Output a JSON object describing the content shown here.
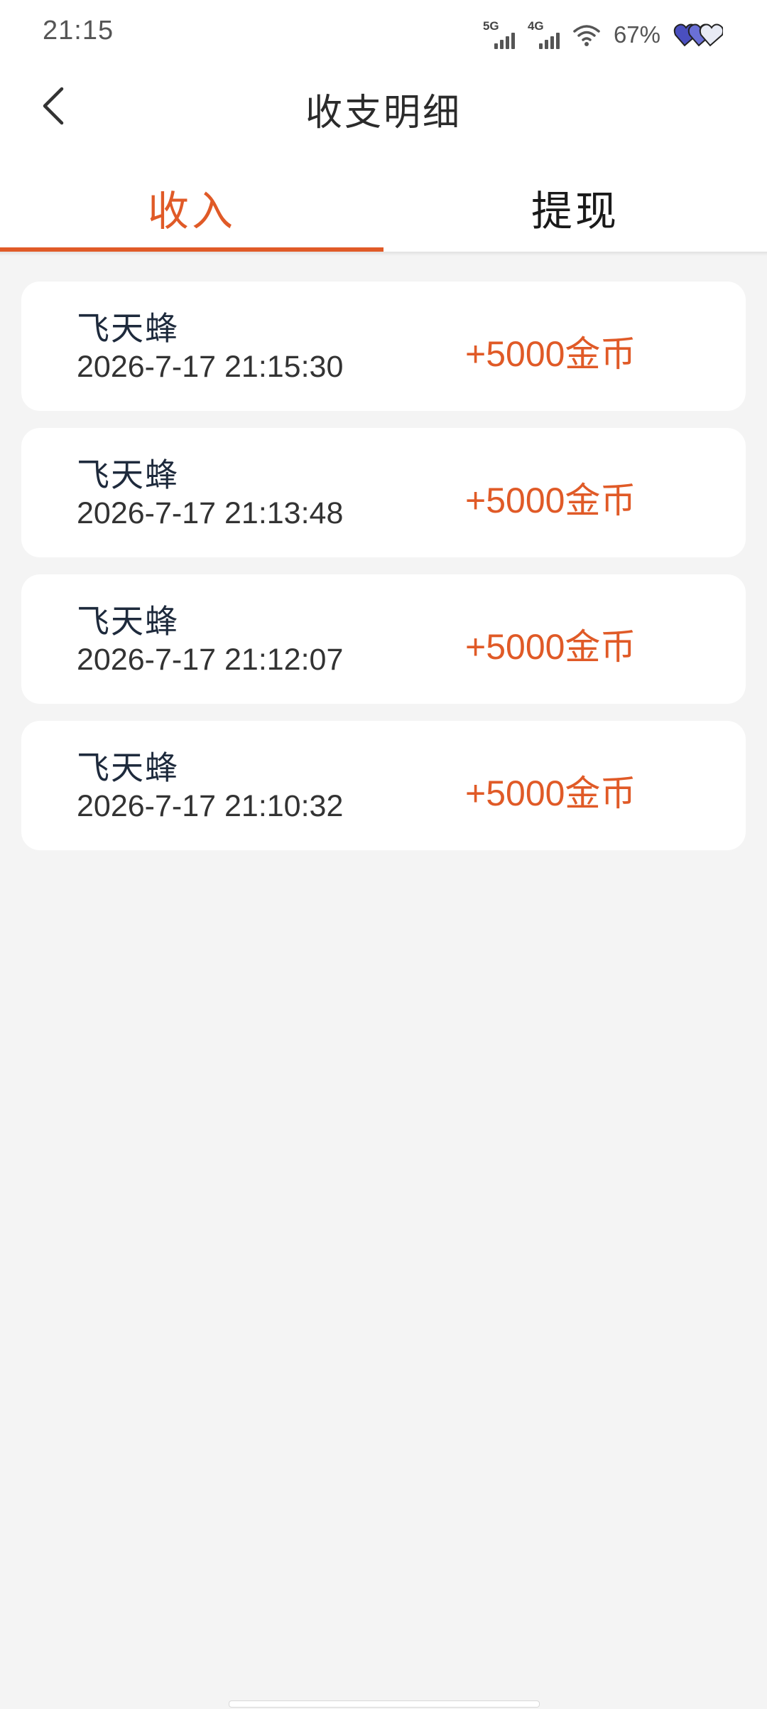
{
  "status_bar": {
    "time": "21:15",
    "network1": "5G",
    "network2": "4G",
    "battery": "67%"
  },
  "header": {
    "title": "收支明细",
    "back_icon": "chevron-left-icon"
  },
  "tabs": [
    {
      "label": "收入",
      "active": true
    },
    {
      "label": "提现",
      "active": false
    }
  ],
  "records": [
    {
      "name": "飞天蜂",
      "time": "2026-7-17 21:15:30",
      "amount": "+5000金币"
    },
    {
      "name": "飞天蜂",
      "time": "2026-7-17 21:13:48",
      "amount": "+5000金币"
    },
    {
      "name": "飞天蜂",
      "time": "2026-7-17 21:12:07",
      "amount": "+5000金币"
    },
    {
      "name": "飞天蜂",
      "time": "2026-7-17 21:10:32",
      "amount": "+5000金币"
    }
  ],
  "colors": {
    "accent": "#e05a27",
    "background": "#f4f4f4",
    "card": "#ffffff"
  }
}
